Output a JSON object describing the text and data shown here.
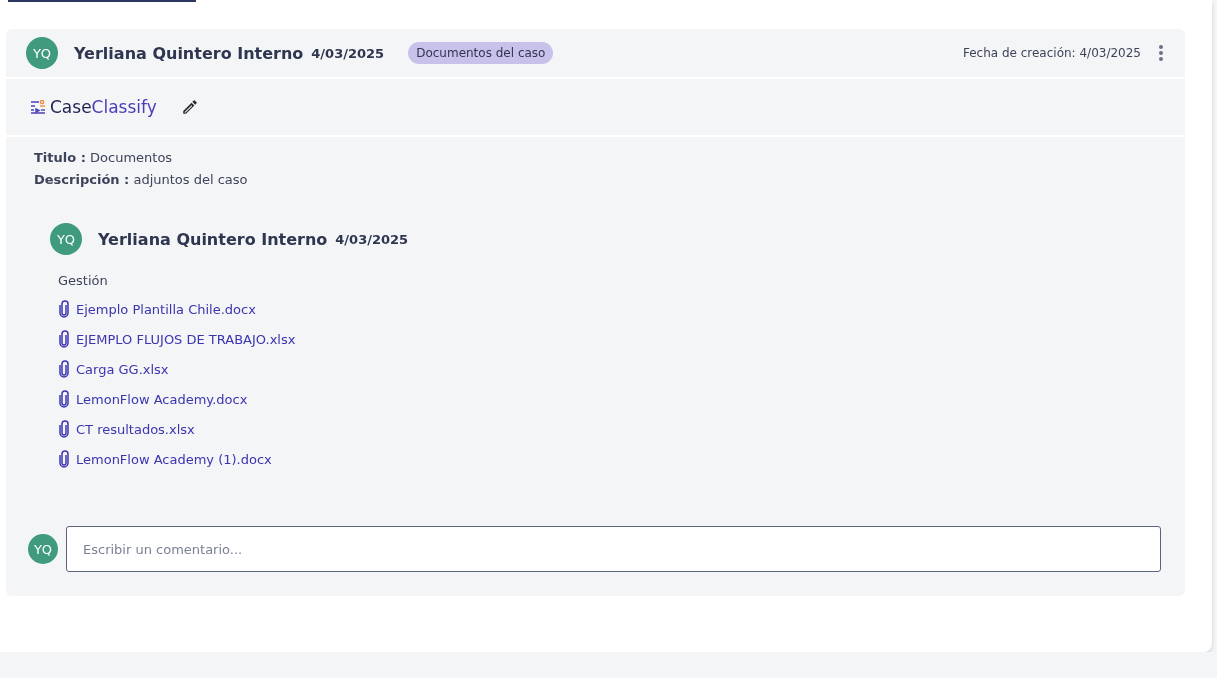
{
  "post": {
    "author": {
      "initials": "YQ",
      "name": "Yerliana Quintero Interno",
      "date": "4/03/2025"
    },
    "tag": "Documentos del caso",
    "created": "Fecha de creación: 4/03/2025",
    "logo": {
      "part_dark": "Case",
      "part_accent": "Classify"
    },
    "fields": [
      {
        "label": "Titulo :",
        "value": "Documentos"
      },
      {
        "label": "Descripción :",
        "value": "adjuntos del caso"
      }
    ],
    "reply": {
      "author": {
        "initials": "YQ",
        "name": "Yerliana Quintero Interno",
        "date": "4/03/2025"
      },
      "section": "Gestión",
      "attachments": [
        "Ejemplo Plantilla Chile.docx",
        "EJEMPLO FLUJOS DE TRABAJO.xlsx",
        "Carga GG.xlsx",
        "LemonFlow Academy.docx",
        "CT resultados.xlsx",
        "LemonFlow Academy (1).docx"
      ]
    },
    "comment": {
      "initials": "YQ",
      "placeholder": "Escribir un comentario..."
    }
  }
}
